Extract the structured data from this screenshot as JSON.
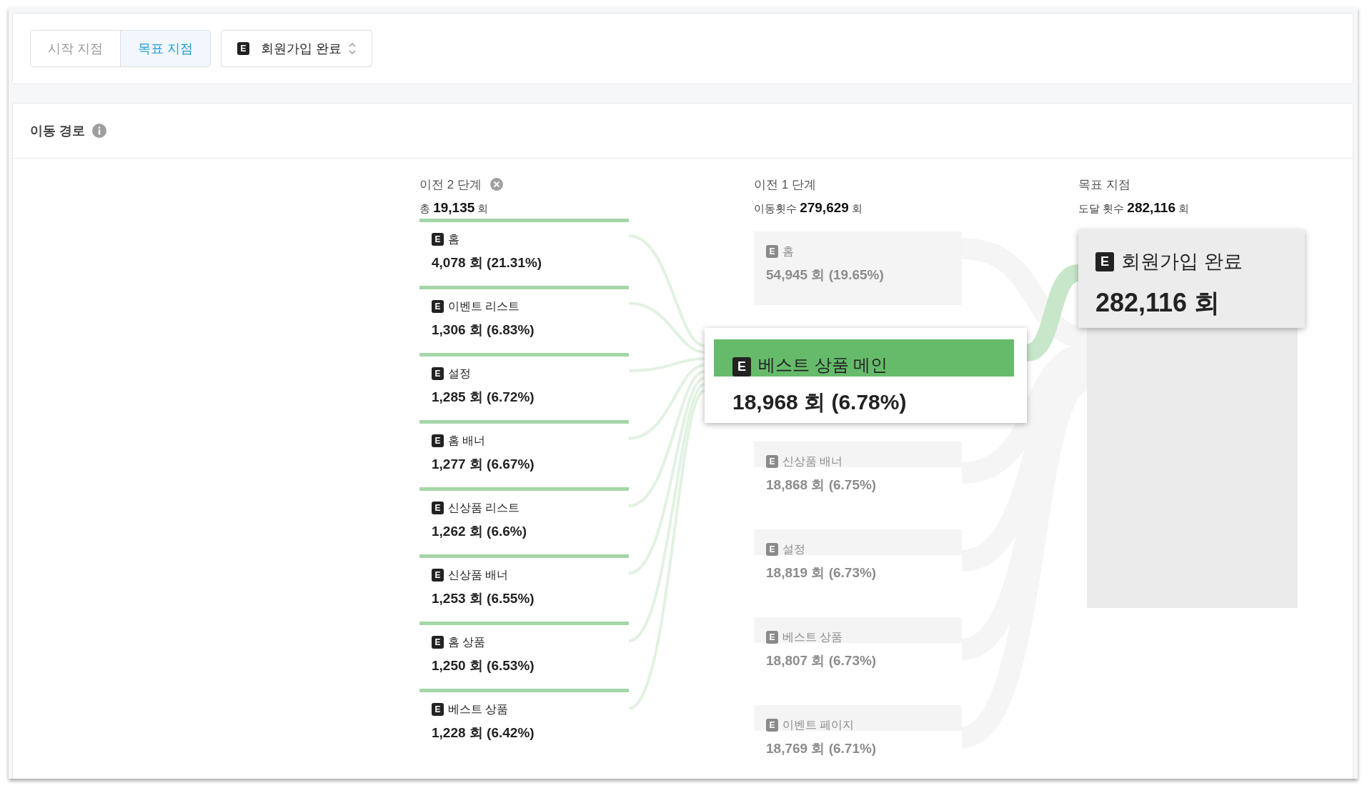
{
  "filter": {
    "tabs": [
      {
        "label": "시작 지점",
        "selected": false
      },
      {
        "label": "목표 지점",
        "selected": true
      }
    ],
    "event_select": {
      "badge": "E",
      "label": "회원가입 완료"
    }
  },
  "section": {
    "title": "이동 경로"
  },
  "step2": {
    "title": "이전 2 단계",
    "summary": "총 **19,135** 회",
    "nodes": [
      {
        "badge": "E",
        "name": "홈",
        "value": "4,078 회 (21.31%)"
      },
      {
        "badge": "E",
        "name": "이벤트 리스트",
        "value": "1,306 회 (6.83%)"
      },
      {
        "badge": "E",
        "name": "설정",
        "value": "1,285 회 (6.72%)"
      },
      {
        "badge": "E",
        "name": "홈 배너",
        "value": "1,277 회 (6.67%)"
      },
      {
        "badge": "E",
        "name": "신상품 리스트",
        "value": "1,262 회 (6.6%)"
      },
      {
        "badge": "E",
        "name": "신상품 배너",
        "value": "1,253 회 (6.55%)"
      },
      {
        "badge": "E",
        "name": "홈 상품",
        "value": "1,250 회 (6.53%)"
      },
      {
        "badge": "E",
        "name": "베스트 상품",
        "value": "1,228 회 (6.42%)"
      }
    ]
  },
  "step1": {
    "title": "이전 1 단계",
    "summary": "이동횟수 **279,629** 회",
    "nodes": [
      {
        "badge": "E",
        "name": "홈",
        "value": "54,945 회 (19.65%)",
        "highlighted": false
      },
      {
        "badge": "E",
        "name": "베스트 상품 메인",
        "value": "18,968 회 (6.78%)",
        "highlighted": true
      },
      {
        "badge": "E",
        "name": "신상품 배너",
        "value": "18,868 회 (6.75%)",
        "highlighted": false
      },
      {
        "badge": "E",
        "name": "설정",
        "value": "18,819 회 (6.73%)",
        "highlighted": false
      },
      {
        "badge": "E",
        "name": "베스트 상품",
        "value": "18,807 회 (6.73%)",
        "highlighted": false
      },
      {
        "badge": "E",
        "name": "이벤트 페이지",
        "value": "18,769 회 (6.71%)",
        "highlighted": false
      }
    ]
  },
  "goal": {
    "title": "목표 지점",
    "summary": "도달 횟수 **282,116** 회",
    "node": {
      "badge": "E",
      "name": "회원가입 완료",
      "value": "282,116 회"
    }
  }
}
